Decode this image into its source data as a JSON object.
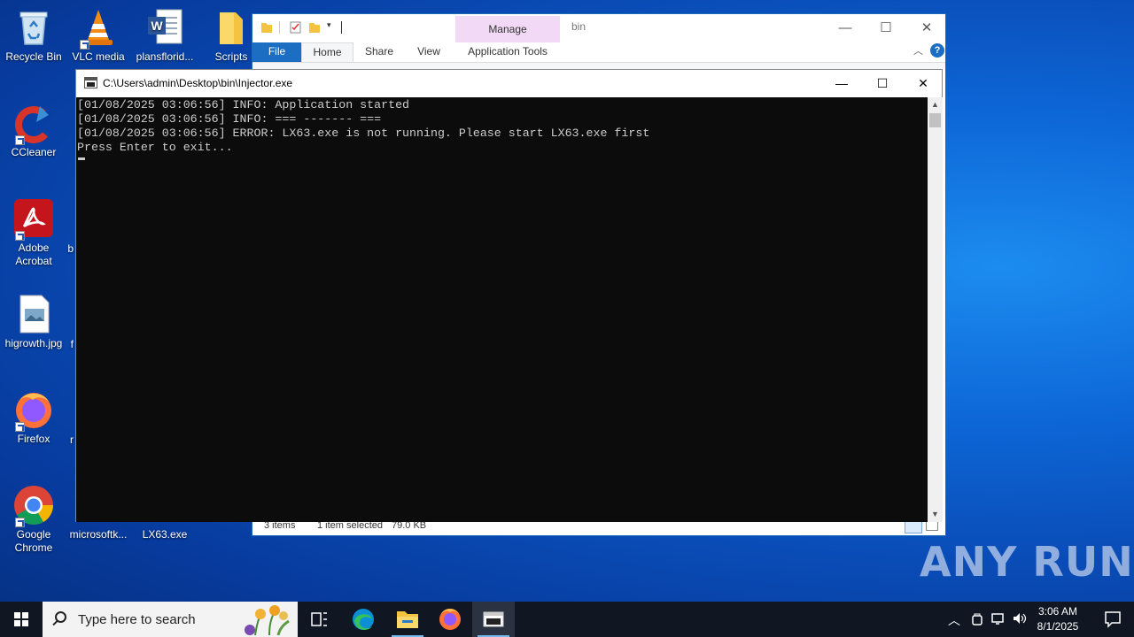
{
  "desktop": {
    "icons": [
      {
        "label": "Recycle Bin"
      },
      {
        "label": "VLC media"
      },
      {
        "label": "plansflorid..."
      },
      {
        "label": "Scripts"
      },
      {
        "label": "CCleaner"
      },
      {
        "label": "Adobe Acrobat"
      },
      {
        "label": "higrowth.jpg"
      },
      {
        "label": "Firefox"
      },
      {
        "label": "Google Chrome"
      },
      {
        "label": "microsoftk..."
      },
      {
        "label": "LX63.exe"
      }
    ],
    "partial_labels": [
      "b",
      "f",
      "r"
    ]
  },
  "explorer": {
    "title": "bin",
    "manage_label": "Manage",
    "tabs": {
      "file": "File",
      "home": "Home",
      "share": "Share",
      "view": "View",
      "app_tools": "Application Tools"
    },
    "status": {
      "items": "3 items",
      "selected": "1 item selected",
      "size": "79.0 KB"
    }
  },
  "console": {
    "title": "C:\\Users\\admin\\Desktop\\bin\\Injector.exe",
    "lines": [
      "[01/08/2025 03:06:56] INFO: Application started",
      "[01/08/2025 03:06:56] INFO: === ------- ===",
      "[01/08/2025 03:06:56] ERROR: LX63.exe is not running. Please start LX63.exe first",
      "Press Enter to exit..."
    ]
  },
  "taskbar": {
    "search_placeholder": "Type here to search",
    "time": "3:06 AM",
    "date": "8/1/2025"
  },
  "watermark": "ANY RUN",
  "colors": {
    "console_bg": "#0c0c0c",
    "console_text": "#cccccc",
    "accent": "#1b6ec2",
    "manage_tab": "#f2d9f5",
    "taskbar": "#101622"
  }
}
